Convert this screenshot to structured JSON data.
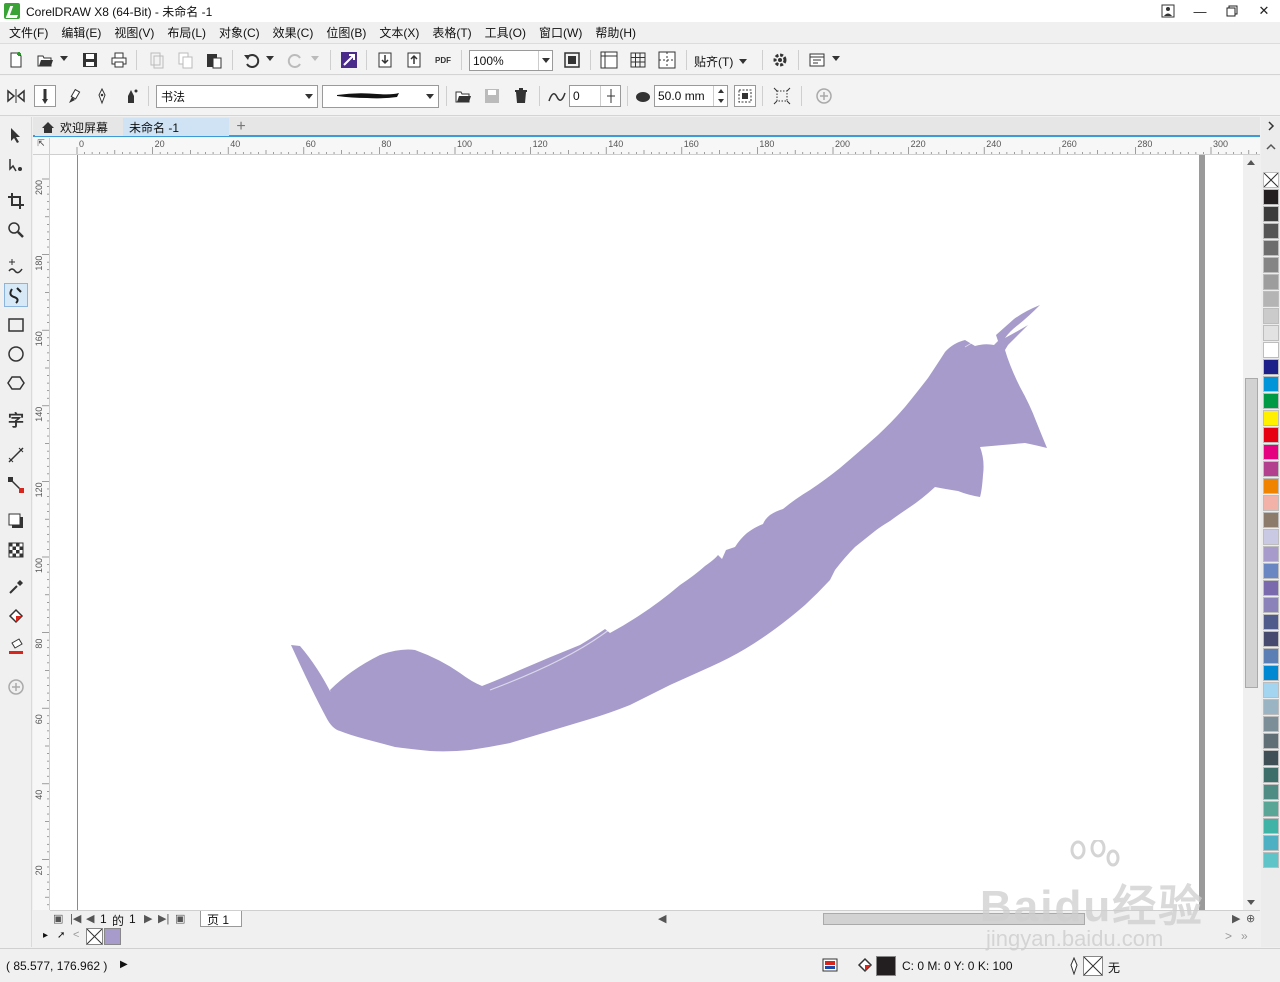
{
  "titlebar": {
    "title": "CorelDRAW X8 (64-Bit) - 未命名 -1"
  },
  "menu": [
    "文件(F)",
    "编辑(E)",
    "视图(V)",
    "布局(L)",
    "对象(C)",
    "效果(C)",
    "位图(B)",
    "文本(X)",
    "表格(T)",
    "工具(O)",
    "窗口(W)",
    "帮助(H)"
  ],
  "toolbar": {
    "zoom": "100%",
    "snap": "贴齐(T)",
    "pdf": "PDF"
  },
  "property_bar": {
    "artistic_media_mode": "书法",
    "smoothing": "0",
    "stroke_width": "50.0 mm"
  },
  "tabs": {
    "welcome": "欢迎屏幕",
    "document": "未命名 -1"
  },
  "ruler": {
    "h_labels": [
      "0",
      "20",
      "40",
      "60",
      "80",
      "100",
      "120",
      "140",
      "160",
      "180",
      "200",
      "220",
      "240",
      "260",
      "280",
      "300"
    ],
    "v_labels": [
      "200",
      "180",
      "160",
      "140",
      "120",
      "100",
      "80",
      "60",
      "40",
      "20"
    ],
    "units": "毫米"
  },
  "canvas": {
    "shape_color": "#a69bca"
  },
  "page_nav": {
    "current": "1",
    "of": "的",
    "total": "1",
    "page_tab": "页 1"
  },
  "palette": [
    "#231f20",
    "#3c3c3c",
    "#555555",
    "#6d6d6d",
    "#858585",
    "#9d9d9d",
    "#b4b4b4",
    "#cbcbcb",
    "#e2e2e2",
    "#ffffff",
    "#1d2088",
    "#0094d9",
    "#009944",
    "#fff000",
    "#e60012",
    "#e4007f",
    "#b2408e",
    "#f08300",
    "#f2b2a7",
    "#8c7b6b",
    "#c9c9e3",
    "#a69bca",
    "#6a86c2",
    "#7a6aad",
    "#8a82b8",
    "#4f5b8a",
    "#454a6e",
    "#5b7fb5",
    "#0089d2",
    "#a3d4f0",
    "#9ab4c4",
    "#7c8f99",
    "#5f6f75",
    "#3f4f55",
    "#3d6e6a",
    "#4e8c84",
    "#59a596",
    "#3fb3a6",
    "#4db0c3",
    "#5fc4c8"
  ],
  "status": {
    "coords": "( 85.577, 176.962 )",
    "fill_text": "C: 0 M: 0 Y: 0 K: 100",
    "outline_text": "无"
  },
  "watermark": {
    "text": "Baidu经验",
    "sub": "jingyan.baidu.com"
  }
}
